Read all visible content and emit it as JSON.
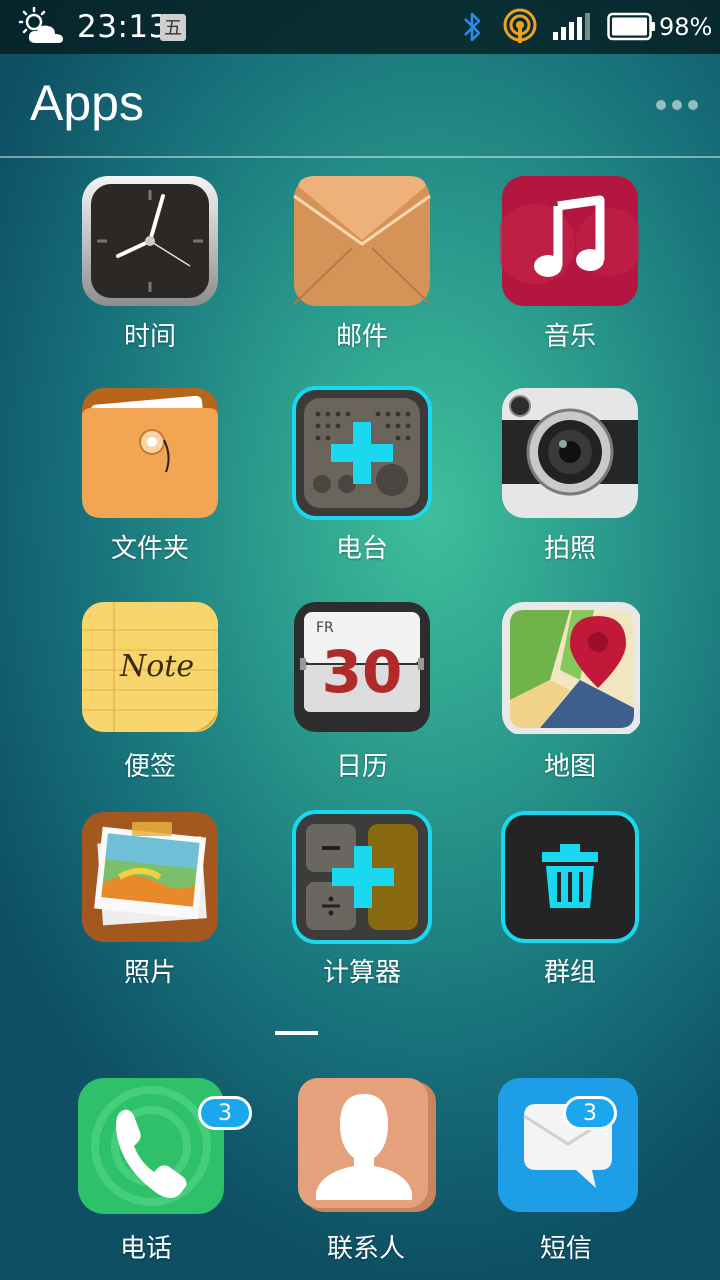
{
  "status": {
    "time": "23:13",
    "weekday": "五",
    "battery": "98%",
    "icons": [
      "weather-partly-cloudy-icon",
      "bluetooth-icon",
      "hotspot-icon",
      "signal-icon",
      "battery-icon"
    ]
  },
  "header": {
    "title": "Apps",
    "more_icon": "more-dots-icon"
  },
  "apps": [
    {
      "label": "时间",
      "icon": "clock-icon"
    },
    {
      "label": "邮件",
      "icon": "envelope-icon"
    },
    {
      "label": "音乐",
      "icon": "music-note-icon"
    },
    {
      "label": "文件夹",
      "icon": "folder-icon"
    },
    {
      "label": "电台",
      "icon": "radio-icon"
    },
    {
      "label": "拍照",
      "icon": "camera-icon"
    },
    {
      "label": "便签",
      "icon": "note-icon",
      "icon_text": "Note"
    },
    {
      "label": "日历",
      "icon": "calendar-icon",
      "day_abbr": "FR",
      "day": "30"
    },
    {
      "label": "地图",
      "icon": "map-pin-icon"
    },
    {
      "label": "照片",
      "icon": "photo-icon"
    },
    {
      "label": "计算器",
      "icon": "calculator-icon"
    },
    {
      "label": "群组",
      "icon": "trash-icon"
    }
  ],
  "dock": [
    {
      "label": "电话",
      "icon": "phone-icon",
      "badge": "3"
    },
    {
      "label": "联系人",
      "icon": "contact-icon"
    },
    {
      "label": "短信",
      "icon": "message-icon",
      "badge": "3"
    }
  ],
  "colors": {
    "accent": "#1ad8f0",
    "badge": "#1aa7ee"
  }
}
